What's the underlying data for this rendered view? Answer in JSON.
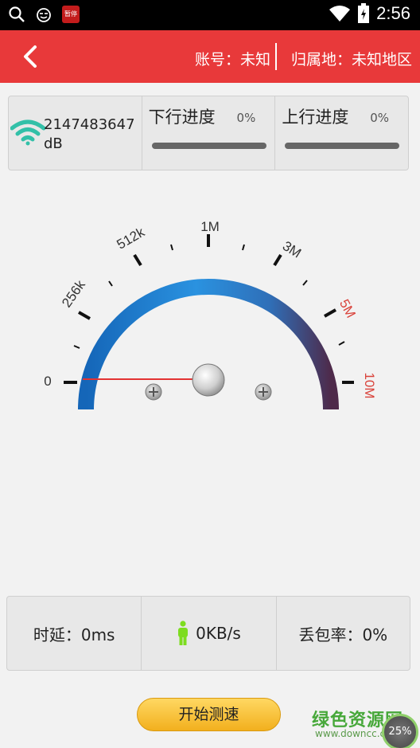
{
  "status_bar": {
    "time": "2:56",
    "icons": [
      "search-icon",
      "cat-face-icon",
      "app-badge-icon",
      "wifi-icon",
      "battery-icon"
    ],
    "app_badge_text": "暂停"
  },
  "header": {
    "back_icon": "chevron-left-icon",
    "account": "账号：未知",
    "region": "归属地：未知地区",
    "color": "#e8393a"
  },
  "top_panel": {
    "signal_icon": "wifi-signal-icon",
    "signal_value_line1": "2147483647",
    "signal_value_line2": "dB",
    "download_label": "下行进度",
    "download_percent": "0%",
    "download_progress": 0,
    "upload_label": "上行进度",
    "upload_percent": "0%",
    "upload_progress": 0
  },
  "gauge": {
    "tick_labels": [
      "0",
      "256k",
      "512k",
      "1M",
      "3M",
      "5M",
      "10M"
    ],
    "needle_value": "0",
    "accent_colors": {
      "arc_start": "#1f86d6",
      "arc_end": "#4a2a4a",
      "needle": "#e33333",
      "high_label": "#d9423a"
    }
  },
  "bottom_panel": {
    "latency": "时延：0ms",
    "speed": "0KB/s",
    "speed_icon": "person-icon",
    "packet_loss": "丢包率：0%"
  },
  "start_button": {
    "label": "开始测速"
  },
  "watermark": {
    "title": "绿色资源网",
    "url": "www.downcc.com",
    "percent": "25%"
  }
}
